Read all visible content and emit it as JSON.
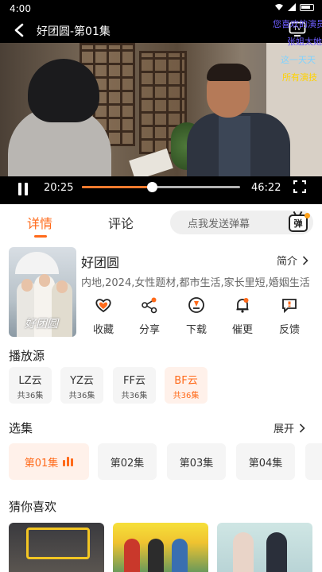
{
  "status": {
    "time": "4:00"
  },
  "player": {
    "title": "好团圆-第01集",
    "current_time": "20:25",
    "total_time": "46:22",
    "progress_fraction": 0.44,
    "danmaku": [
      "您喜欢的演员",
      "张姐太她",
      "这一天天",
      "所有演技"
    ]
  },
  "tabs": {
    "details": "详情",
    "comments": "评论"
  },
  "danmaku_input": {
    "placeholder": "点我发送弹幕",
    "toggle_label": "弹"
  },
  "show": {
    "title": "好团圆",
    "intro_label": "简介",
    "tags": "内地,2024,女性题材,都市生活,家长里短,婚姻生活",
    "poster_text": "好团圆"
  },
  "actions": [
    {
      "label": "收藏",
      "icon": "heart-icon"
    },
    {
      "label": "分享",
      "icon": "share-icon"
    },
    {
      "label": "下载",
      "icon": "download-icon"
    },
    {
      "label": "催更",
      "icon": "bell-icon"
    },
    {
      "label": "反馈",
      "icon": "feedback-icon"
    }
  ],
  "sources_section": {
    "title": "播放源",
    "items": [
      {
        "name": "LZ云",
        "count": "共36集",
        "active": false
      },
      {
        "name": "YZ云",
        "count": "共36集",
        "active": false
      },
      {
        "name": "FF云",
        "count": "共36集",
        "active": false
      },
      {
        "name": "BF云",
        "count": "共36集",
        "active": true
      }
    ]
  },
  "episodes_section": {
    "title": "选集",
    "expand_label": "展开",
    "items": [
      "第01集",
      "第02集",
      "第03集",
      "第04集"
    ],
    "active_index": 0
  },
  "recommend_section": {
    "title": "猜你喜欢"
  },
  "colors": {
    "accent": "#ff6a1a",
    "accent_bg": "#fff1ea",
    "danmaku_purple": "#6d5cff",
    "danmaku_blue": "#7fd2ff",
    "danmaku_yellow": "#ffd200"
  }
}
